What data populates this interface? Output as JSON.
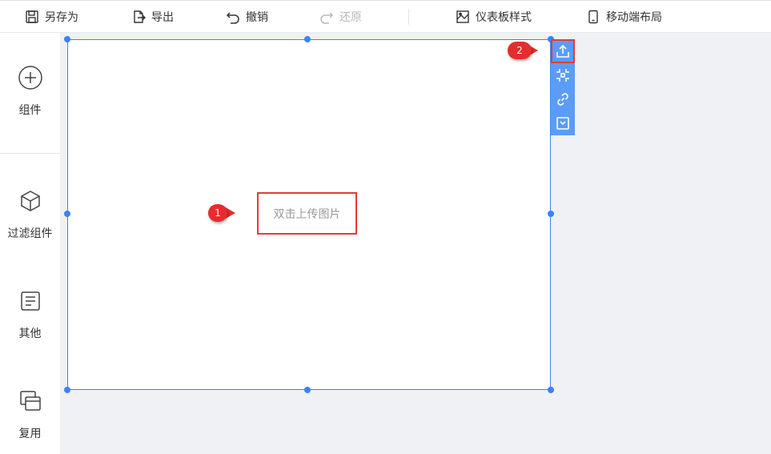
{
  "toolbar": {
    "save_as": "另存为",
    "export": "导出",
    "undo": "撤销",
    "redo": "还原",
    "dashboard_style": "仪表板样式",
    "mobile_layout": "移动端布局"
  },
  "sidebar": {
    "items": [
      {
        "label": "组件",
        "icon": "plus-circle-icon"
      },
      {
        "label": "过滤组件",
        "icon": "cube-icon"
      },
      {
        "label": "其他",
        "icon": "document-icon"
      },
      {
        "label": "复用",
        "icon": "layers-icon"
      }
    ]
  },
  "widget": {
    "upload_hint": "双击上传图片",
    "tools": [
      "upload-icon",
      "fullscreen-icon",
      "link-icon",
      "dropdown-icon"
    ]
  },
  "annotations": {
    "step1": "1",
    "step2": "2"
  },
  "colors": {
    "accent": "#3b82f6",
    "tool_bg": "#5b9cf8",
    "annotation_red": "#e52d2d"
  }
}
